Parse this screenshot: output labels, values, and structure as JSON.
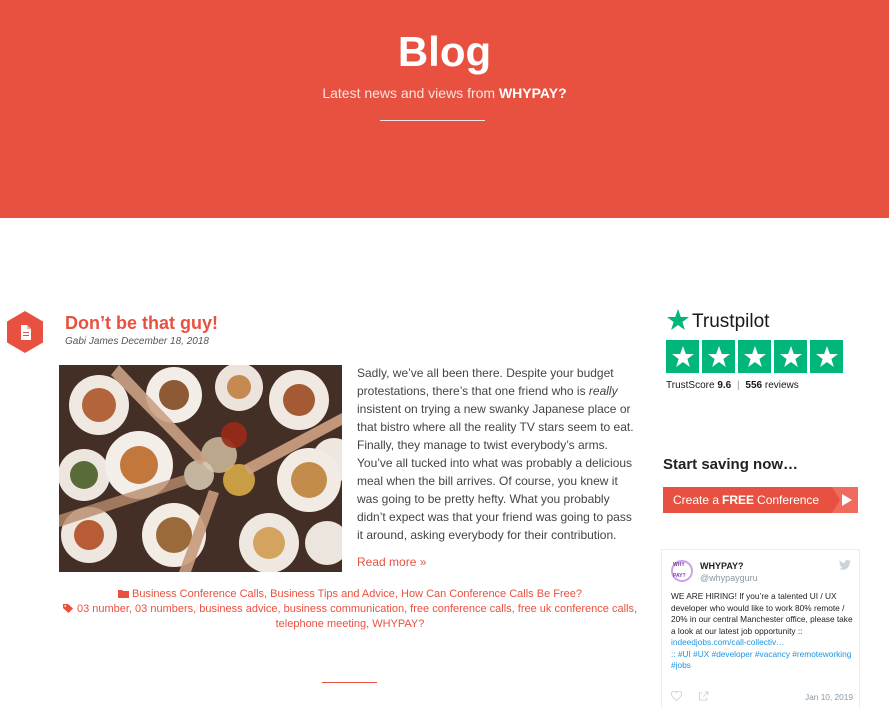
{
  "hero": {
    "title": "Blog",
    "subtitle_prefix": "Latest news and views from",
    "subtitle_brand": "WHYPAY?"
  },
  "post": {
    "title": "Don’t be that guy!",
    "meta": "Gabi James December 18, 2018",
    "body_before_em": "Sadly, we’ve all been there. Despite your budget protestations, there’s that one friend who is ",
    "body_em": "really",
    "body_after_em": " insistent on trying a new swanky Japanese place or that bistro where all the reality TV stars seem to eat. Finally, they manage to twist everybody’s arms. You’ve all tucked into what was probably a delicious meal when the bill arrives. Of course, you knew it was going to be pretty hefty. What you probably didn’t expect was that your friend was going to pass it around, asking everybody for their contribution.",
    "read_more": "Read more »",
    "categories": "Business Conference Calls, Business Tips and Advice, How Can Conference Calls Be Free?",
    "tags": "03 number, 03 numbers, business advice, business communication, free conference calls, free uk conference calls, telephone meeting, WHYPAY?"
  },
  "trustpilot": {
    "brand": "Trustpilot",
    "score_label": "TrustScore",
    "score": "9.6",
    "separator": "|",
    "reviews_count": "556",
    "reviews_label": "reviews",
    "stars": 5,
    "star_color": "#00b67a"
  },
  "sidebar": {
    "saving_title": "Start saving now…",
    "cta_prefix": "Create a",
    "cta_bold": "FREE",
    "cta_suffix": "Conference"
  },
  "tweet": {
    "name": "WHYPAY?",
    "handle": "@whypayguru",
    "avatar_text": "WHY PAY?",
    "text": "WE ARE HIRING! If you’re a talented UI / UX developer who would like to work 80% remote / 20% in our central Manchester office, please take a look at our latest job opportunity ::",
    "link": "indeedjobs.com/call-collectiv…",
    "hashtags": ":: #UI #UX #developer #vacancy #remoteworking #jobs",
    "date": "Jan 10, 2019"
  },
  "colors": {
    "brand": "#e85140",
    "trustpilot_green": "#00b67a",
    "twitter_link": "#1b95e0"
  }
}
